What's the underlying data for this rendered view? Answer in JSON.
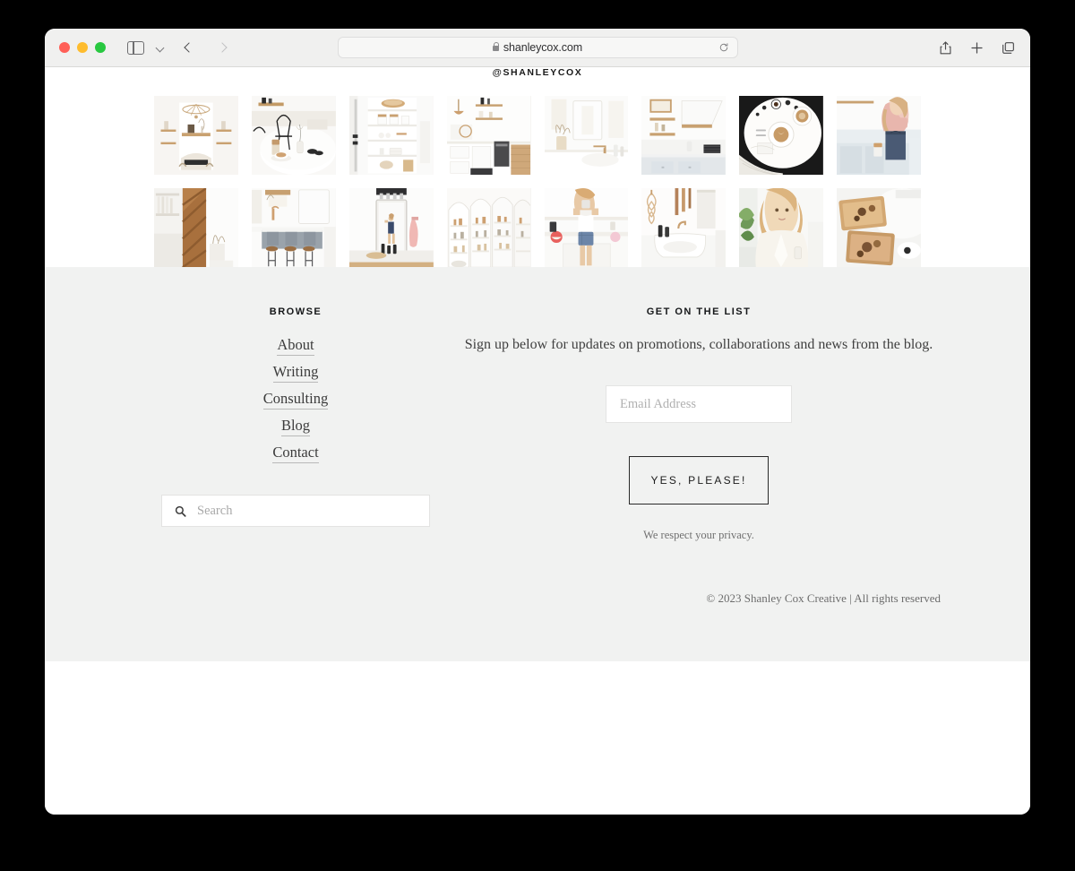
{
  "browser": {
    "url": "shanleycox.com",
    "lock_icon": "lock-icon",
    "reload_icon": "reload-icon",
    "sidebar_icon": "sidebar-toggle-icon",
    "chevron_icon": "chevron-down-icon",
    "back_icon": "back-arrow-icon",
    "forward_icon": "forward-arrow-icon",
    "share_icon": "share-icon",
    "new_tab_icon": "plus-icon",
    "tabs_icon": "tab-overview-icon"
  },
  "page": {
    "instagram_handle": "@SHANLEYCOX",
    "gallery": {
      "rows": 2,
      "columns": 8,
      "items": [
        {
          "alt": "white kitchen with brass chandelier and open shelving"
        },
        {
          "alt": "round white table with latte and black chairs"
        },
        {
          "alt": "white built-in shelving with baskets and linens"
        },
        {
          "alt": "bright kitchen with rattan pendant light"
        },
        {
          "alt": "white bathroom with dried florals and brass faucet"
        },
        {
          "alt": "floating wood shelves above white range hood"
        },
        {
          "alt": "flatlay of coffee cups on marble table"
        },
        {
          "alt": "woman in pink sweater holding mug in kitchen"
        },
        {
          "alt": "wood framed mirror against white wall"
        },
        {
          "alt": "grey kitchen island with leather barstools"
        },
        {
          "alt": "full length mirror selfie in white bathroom"
        },
        {
          "alt": "arched white pantry with shelves of goods"
        },
        {
          "alt": "woman seated on white kitchen counter"
        },
        {
          "alt": "white pedestal sink with macrame wall hanging"
        },
        {
          "alt": "blonde woman in cream blouse with drink"
        },
        {
          "alt": "wood serving trays flatlay with pastries"
        }
      ]
    }
  },
  "footer": {
    "browse": {
      "heading": "BROWSE",
      "links": [
        {
          "label": "About"
        },
        {
          "label": "Writing"
        },
        {
          "label": "Consulting"
        },
        {
          "label": "Blog"
        },
        {
          "label": "Contact"
        }
      ],
      "search_placeholder": "Search",
      "search_icon": "search-icon"
    },
    "newsletter": {
      "heading": "GET ON THE LIST",
      "description": "Sign up below for updates on promotions, collaborations and news from the blog.",
      "email_placeholder": "Email Address",
      "submit_label": "YES, PLEASE!",
      "privacy_note": "We respect your privacy."
    },
    "copyright": "© 2023 Shanley Cox Creative  |  All rights reserved"
  },
  "colors": {
    "footer_bg": "#f1f2f1",
    "page_bg": "#ffffff",
    "toolbar_bg": "#f0f0ef",
    "text_dark": "#1c1c1c",
    "text_muted": "#6d6d6d",
    "button_border": "#2a2a2a"
  }
}
